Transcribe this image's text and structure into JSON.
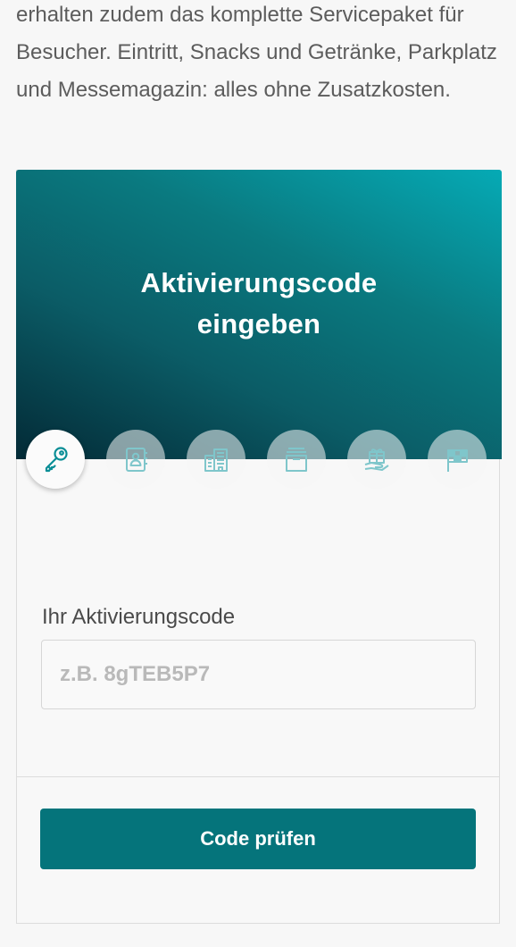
{
  "intro": {
    "text": "erhalten zudem das komplette Servicepaket für Besucher. Eintritt, Snacks und Getränke, Parkplatz und Messemagazin: alles ohne Zusatzkosten."
  },
  "hero": {
    "title_line1": "Aktivierungscode",
    "title_line2": "eingeben"
  },
  "steps": [
    {
      "icon": "key-icon",
      "active": true
    },
    {
      "icon": "contact-card-icon",
      "active": false
    },
    {
      "icon": "building-icon",
      "active": false
    },
    {
      "icon": "box-icon",
      "active": false
    },
    {
      "icon": "gift-icon",
      "active": false
    },
    {
      "icon": "flag-icon",
      "active": false
    }
  ],
  "form": {
    "label": "Ihr Aktivierungscode",
    "placeholder": "z.B. 8gTEB5P7",
    "value": "",
    "submit_label": "Code prüfen"
  },
  "colors": {
    "accent": "#05747b",
    "icon_active": "#0a8e96",
    "icon_inactive": "#7fc6cb"
  }
}
